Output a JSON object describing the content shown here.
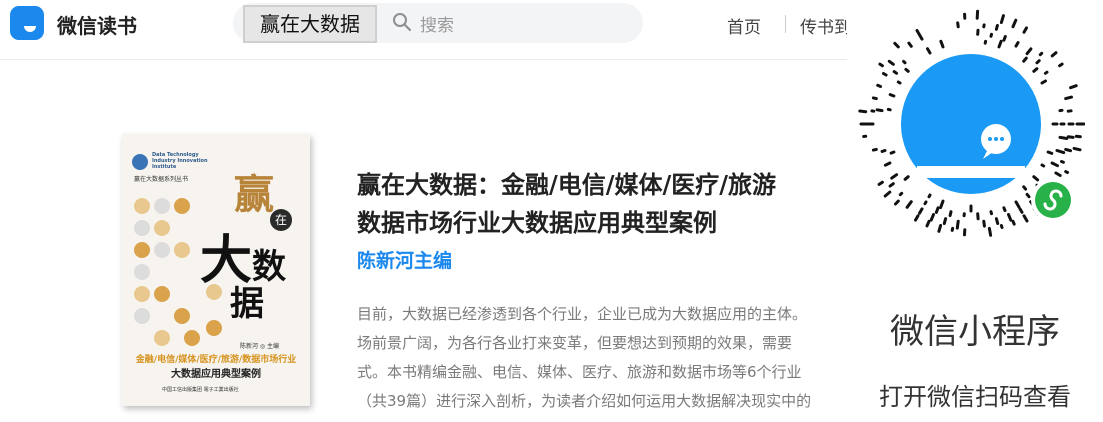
{
  "header": {
    "app_name": "微信读书",
    "search_tag": "赢在大数据",
    "search_placeholder": "搜索",
    "nav": {
      "home": "首页",
      "upload": "传书到"
    }
  },
  "book": {
    "title_lines": [
      "赢在大数据：金融/电信/媒体/医疗/旅游",
      "数据市场行业大数据应用典型案例"
    ],
    "author": "陈新河主编",
    "intro_lines": [
      "目前，大数据已经渗透到各个行业，企业已成为大数据应用的主体。",
      "场前景广阔，为各行各业打来变革，但要想达到预期的效果，需要",
      "式。本书精编金融、电信、媒体、医疗、旅游和数据市场等6个行业",
      "（共39篇）进行深入剖析，为读者介绍如何运用大数据解决现实中的"
    ],
    "cover": {
      "en_line": "Data Technology Industry Innovation Institute",
      "series": "赢在大数据系列丛书",
      "title_chars": [
        "赢",
        "在",
        "大",
        "数",
        "据"
      ],
      "author": "陈新河 ◎ 主编",
      "subtitle_1": "金融/电信/媒体/医疗/旅游/数据市场行业",
      "subtitle_2": "大数据应用典型案例",
      "publisher": "中国工信出版集团  電子工業出版社"
    }
  },
  "mini_program": {
    "label": "微信小程序",
    "hint": "打开微信扫码查看"
  },
  "colors": {
    "brand": "#1b88ee",
    "cover_gold": "#b8843a",
    "mini_badge": "#27b148"
  }
}
